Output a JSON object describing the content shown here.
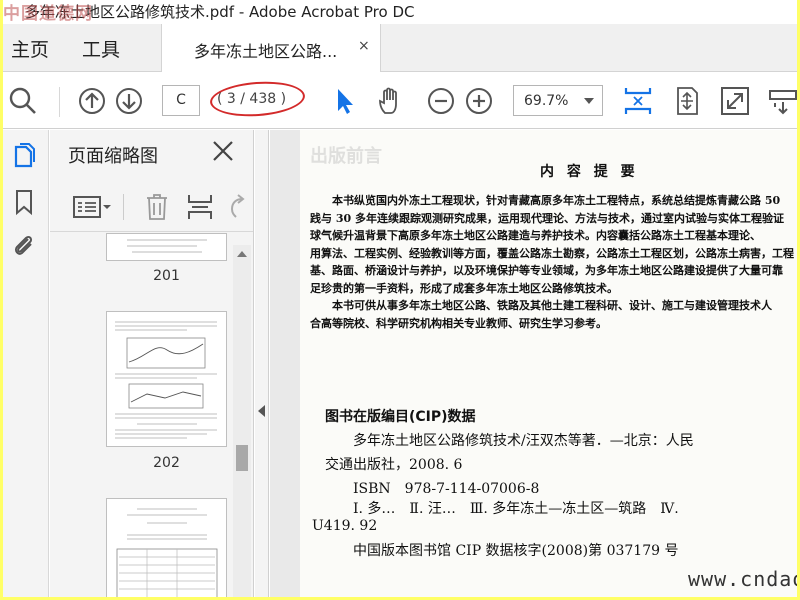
{
  "window": {
    "title": "多年冻土地区公路修筑技术.pdf - Adobe Acrobat Pro DC",
    "watermark": "中国道德网"
  },
  "tabs": {
    "home": "主页",
    "tools": "工具",
    "document": "多年冻土地区公路...",
    "close": "×"
  },
  "toolbar": {
    "page_input": "C",
    "page_count": "( 3 / 438 )",
    "zoom": "69.7%"
  },
  "sidebar": {
    "panel_title": "页面缩略图",
    "thumbnails": [
      "201",
      "202"
    ]
  },
  "page": {
    "ghost_heading": "出版前言",
    "heading": "内 容 提 要",
    "summary_lines": [
      "　　本书纵览国内外冻土工程现状，针对青藏高原多年冻土工程特点，系统总结提炼青藏公路 50",
      "践与 30 多年连续跟踪观测研究成果，运用现代理论、方法与技术，通过室内试验与实体工程验证",
      "球气候升温背景下高原多年冻土地区公路建造与养护技术。内容囊括公路冻土工程基本理论、",
      "用算法、工程实例、经验教训等方面，覆盖公路冻土勘察，公路冻土工程区划，公路冻土病害，工程",
      "基、路面、桥涵设计与养护，以及环境保护等专业领域，为多年冻土地区公路建设提供了大量可靠",
      "足珍贵的第一手资料，形成了成套多年冻土地区公路修筑技术。",
      "　　本书可供从事多年冻土地区公路、铁路及其他土建工程科研、设计、施工与建设管理技术人",
      "合高等院校、科学研究机构相关专业教师、研究生学习参考。"
    ],
    "cip_title": "图书在版编目(CIP)数据",
    "cip_lines": [
      "　　多年冻土地区公路修筑技术/汪双杰等著．—北京：人民",
      "交通出版社，2008. 6",
      "　　ISBN　978-7-114-07006-8",
      "　　Ⅰ. 多…　Ⅱ. 汪…　Ⅲ. 多年冻土—冻土区—筑路　Ⅳ.",
      "U419. 92",
      "　　中国版本图书馆 CIP 数据核字(2008)第 037179 号"
    ],
    "website": "www.cndao.com"
  },
  "colors": {
    "accent": "#1473e6",
    "highlight_ring": "#d32a2a",
    "frame": "#ffff66"
  }
}
